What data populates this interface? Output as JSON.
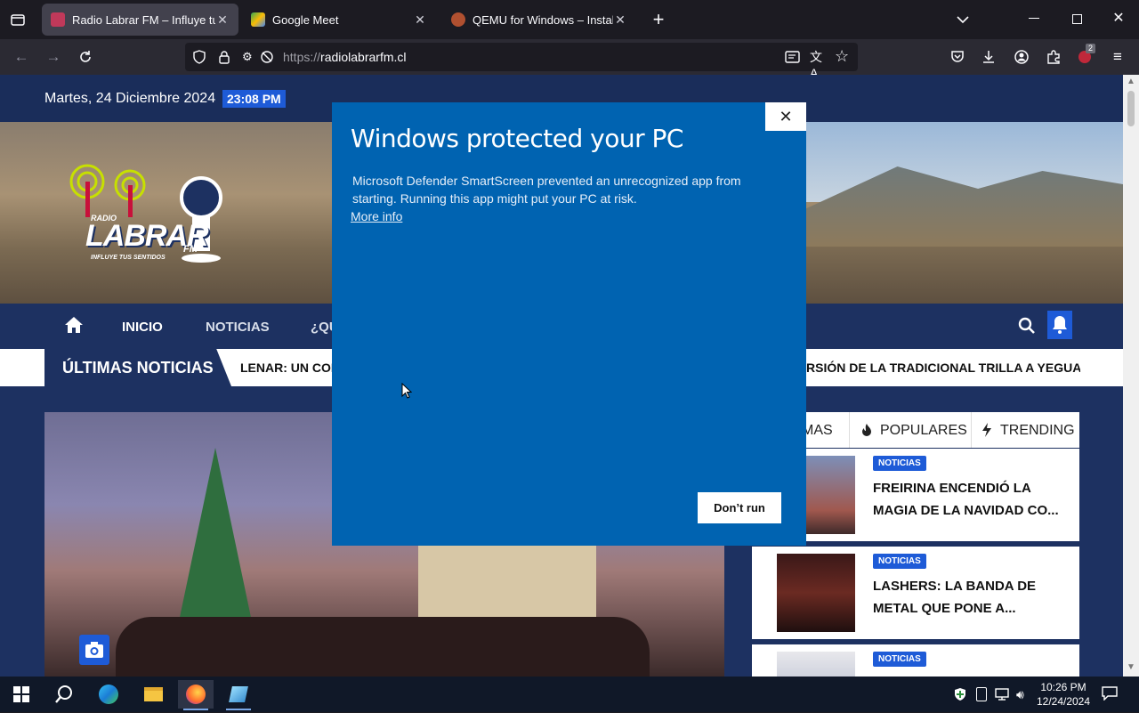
{
  "browser": {
    "tabs": [
      {
        "title": "Radio Labrar FM – Influye tus se",
        "active": true,
        "favicon_color": "#c0395a"
      },
      {
        "title": "Google Meet",
        "active": false,
        "favicon_color": "#34a853"
      },
      {
        "title": "QEMU for Windows – Installers",
        "active": false,
        "favicon_color": "#b05030"
      }
    ],
    "new_tab_icon": "plus-icon",
    "url_protocol": "https://",
    "url_host": "radiolabrarfm.cl",
    "extension_badge": "2"
  },
  "site": {
    "date": "Martes, 24 Diciembre 2024",
    "time": "23:08 PM",
    "logo": {
      "line1": "RADIO",
      "line2": "LABRAR",
      "line3": "FM",
      "tagline": "INFLUYE TUS SENTIDOS"
    },
    "menu": [
      "INICIO",
      "NOTICIAS",
      "¿QU"
    ],
    "ticker_label": "ÚLTIMAS NOTICIAS",
    "ticker_items": [
      "LENAR: UN COMP",
      "RSIÓN DE LA TRADICIONAL TRILLA A YEGUA SUE"
    ],
    "side_tabs": [
      "MAS",
      "POPULARES",
      "TRENDING"
    ],
    "cards": [
      {
        "badge": "NOTICIAS",
        "title": "FREIRINA ENCENDIÓ LA MAGIA DE LA NAVIDAD CO..."
      },
      {
        "badge": "NOTICIAS",
        "title": "LASHERS: LA BANDA DE METAL QUE PONE A..."
      },
      {
        "badge": "NOTICIAS",
        "title": ""
      }
    ],
    "accent": "#1e5bd7"
  },
  "dialog": {
    "title": "Windows protected your PC",
    "body": "Microsoft Defender SmartScreen prevented an unrecognized app from starting. Running this app might put your PC at risk.",
    "more_info": "More info",
    "button": "Don’t run",
    "close": "✕",
    "color": "#0063b1"
  },
  "taskbar": {
    "time": "10:26 PM",
    "date": "12/24/2024"
  }
}
